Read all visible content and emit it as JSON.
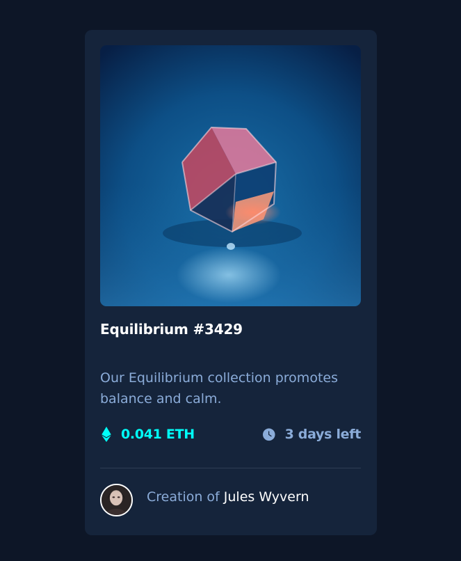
{
  "card": {
    "title": "Equilibrium #3429",
    "description": "Our Equilibrium collection promotes balance and calm.",
    "price": "0.041 ETH",
    "time_left": "3 days left",
    "creator_prefix": "Creation of ",
    "creator_name": "Jules Wyvern"
  },
  "icons": {
    "price": "ethereum-icon",
    "time": "clock-icon"
  },
  "colors": {
    "page_bg": "#0d1627",
    "card_bg": "#15243b",
    "accent": "#00fff8",
    "soft_blue": "#8bacd9",
    "white": "#ffffff"
  }
}
